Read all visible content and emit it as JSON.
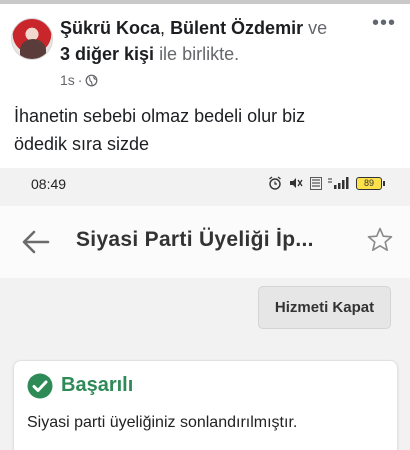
{
  "post": {
    "author_primary": "Şükrü Koca",
    "comma": ",",
    "author_secondary": "Bülent Özdemir",
    "connector": "ve",
    "others": "3 diğer kişi",
    "with_text": "ile birlikte.",
    "time": "1s",
    "meta_sep": "·",
    "privacy_icon": "globe-icon",
    "more_label": "•••",
    "text_line1": "İhanetin sebebi olmaz bedeli olur biz",
    "text_line2": "ödedik sıra sizde"
  },
  "phone": {
    "status_time": "08:49",
    "battery_level": "89",
    "status_icons": [
      "alarm-icon",
      "mute-icon",
      "volte-icon",
      "signal-icon",
      "battery-icon"
    ],
    "appbar_title": "Siyasi Parti Üyeliği İp...",
    "close_service_label": "Hizmeti Kapat",
    "success_title": "Başarılı",
    "success_message": "Siyasi parti üyeliğiniz sonlandırılmıştır."
  },
  "colors": {
    "success_green": "#2e8b57",
    "battery_yellow": "#ffe14a",
    "text_dark": "#1c1e21",
    "meta_gray": "#65676b"
  }
}
